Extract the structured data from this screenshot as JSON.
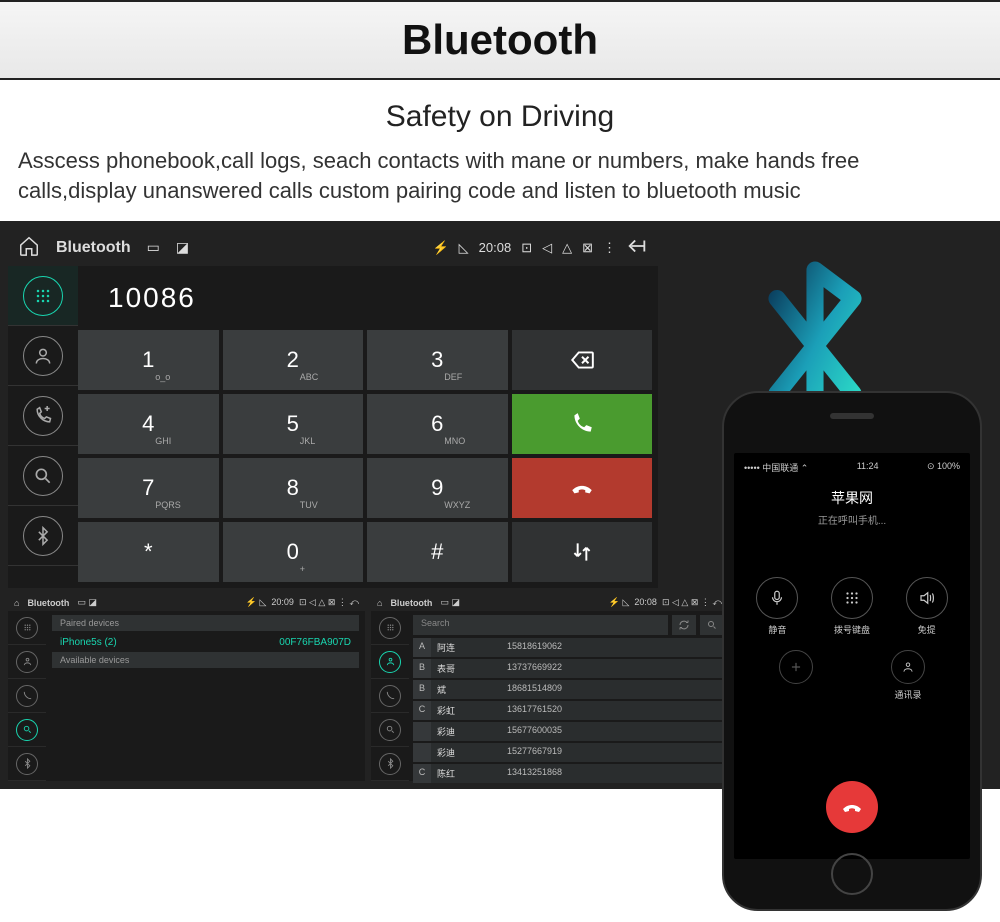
{
  "header": {
    "title": "Bluetooth"
  },
  "subtitle": "Safety on Driving",
  "description": "Asscess phonebook,call logs, seach contacts with mane or numbers, make hands free calls,display unanswered calls custom pairing code and listen to bluetooth music",
  "dialer": {
    "statusbar": {
      "title": "Bluetooth",
      "time": "20:08"
    },
    "display_number": "10086",
    "keys": [
      {
        "d": "1",
        "s": "o_o"
      },
      {
        "d": "2",
        "s": "ABC"
      },
      {
        "d": "3",
        "s": "DEF"
      },
      {
        "d": "4",
        "s": "GHI"
      },
      {
        "d": "5",
        "s": "JKL"
      },
      {
        "d": "6",
        "s": "MNO"
      },
      {
        "d": "7",
        "s": "PQRS"
      },
      {
        "d": "8",
        "s": "TUV"
      },
      {
        "d": "9",
        "s": "WXYZ"
      },
      {
        "d": "*",
        "s": ""
      },
      {
        "d": "0",
        "s": "+"
      },
      {
        "d": "#",
        "s": ""
      }
    ]
  },
  "mini1": {
    "statusbar": {
      "title": "Bluetooth",
      "time": "20:09"
    },
    "paired_label": "Paired devices",
    "paired_name": "iPhone5s (2)",
    "paired_addr": "00F76FBA907D",
    "avail_label": "Available devices"
  },
  "mini2": {
    "statusbar": {
      "title": "Bluetooth",
      "time": "20:08"
    },
    "search_placeholder": "Search",
    "contacts": [
      {
        "l": "A",
        "n": "阿连",
        "p": "15818619062"
      },
      {
        "l": "B",
        "n": "表哥",
        "p": "13737669922"
      },
      {
        "l": "B",
        "n": "斌",
        "p": "18681514809"
      },
      {
        "l": "C",
        "n": "彩虹",
        "p": "13617761520"
      },
      {
        "l": "",
        "n": "彩迪",
        "p": "15677600035"
      },
      {
        "l": "",
        "n": "彩迪",
        "p": "15277667919"
      },
      {
        "l": "C",
        "n": "陈红",
        "p": "13413251868"
      }
    ]
  },
  "iphone": {
    "status_left": "••••• 中国联通 ⌃",
    "status_time": "11:24",
    "status_right": "⊙ 100%",
    "title": "苹果网",
    "subtitle": "正在呼叫手机...",
    "btns": [
      "静音",
      "拨号键盘",
      "免提"
    ],
    "btns2": [
      "",
      "通讯录"
    ]
  }
}
